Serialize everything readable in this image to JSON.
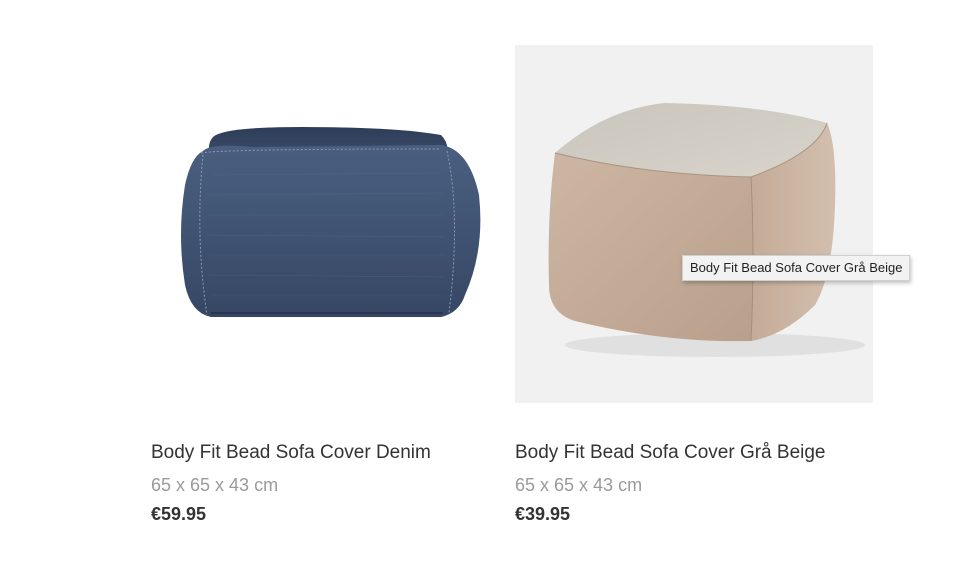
{
  "products": [
    {
      "title": "Body Fit Bead Sofa Cover Denim",
      "dimensions": "65 x 65 x 43 cm",
      "price": "€59.95",
      "image_icon": "denim-bead-sofa-image",
      "color": "#3f5474"
    },
    {
      "title": "Body Fit Bead Sofa Cover Grå Beige",
      "dimensions": "65 x 65 x 43 cm",
      "price": "€39.95",
      "image_icon": "beige-bead-sofa-image",
      "color": "#c7b19f"
    }
  ],
  "tooltip": {
    "text": "Body Fit Bead Sofa Cover Grå Beige"
  }
}
